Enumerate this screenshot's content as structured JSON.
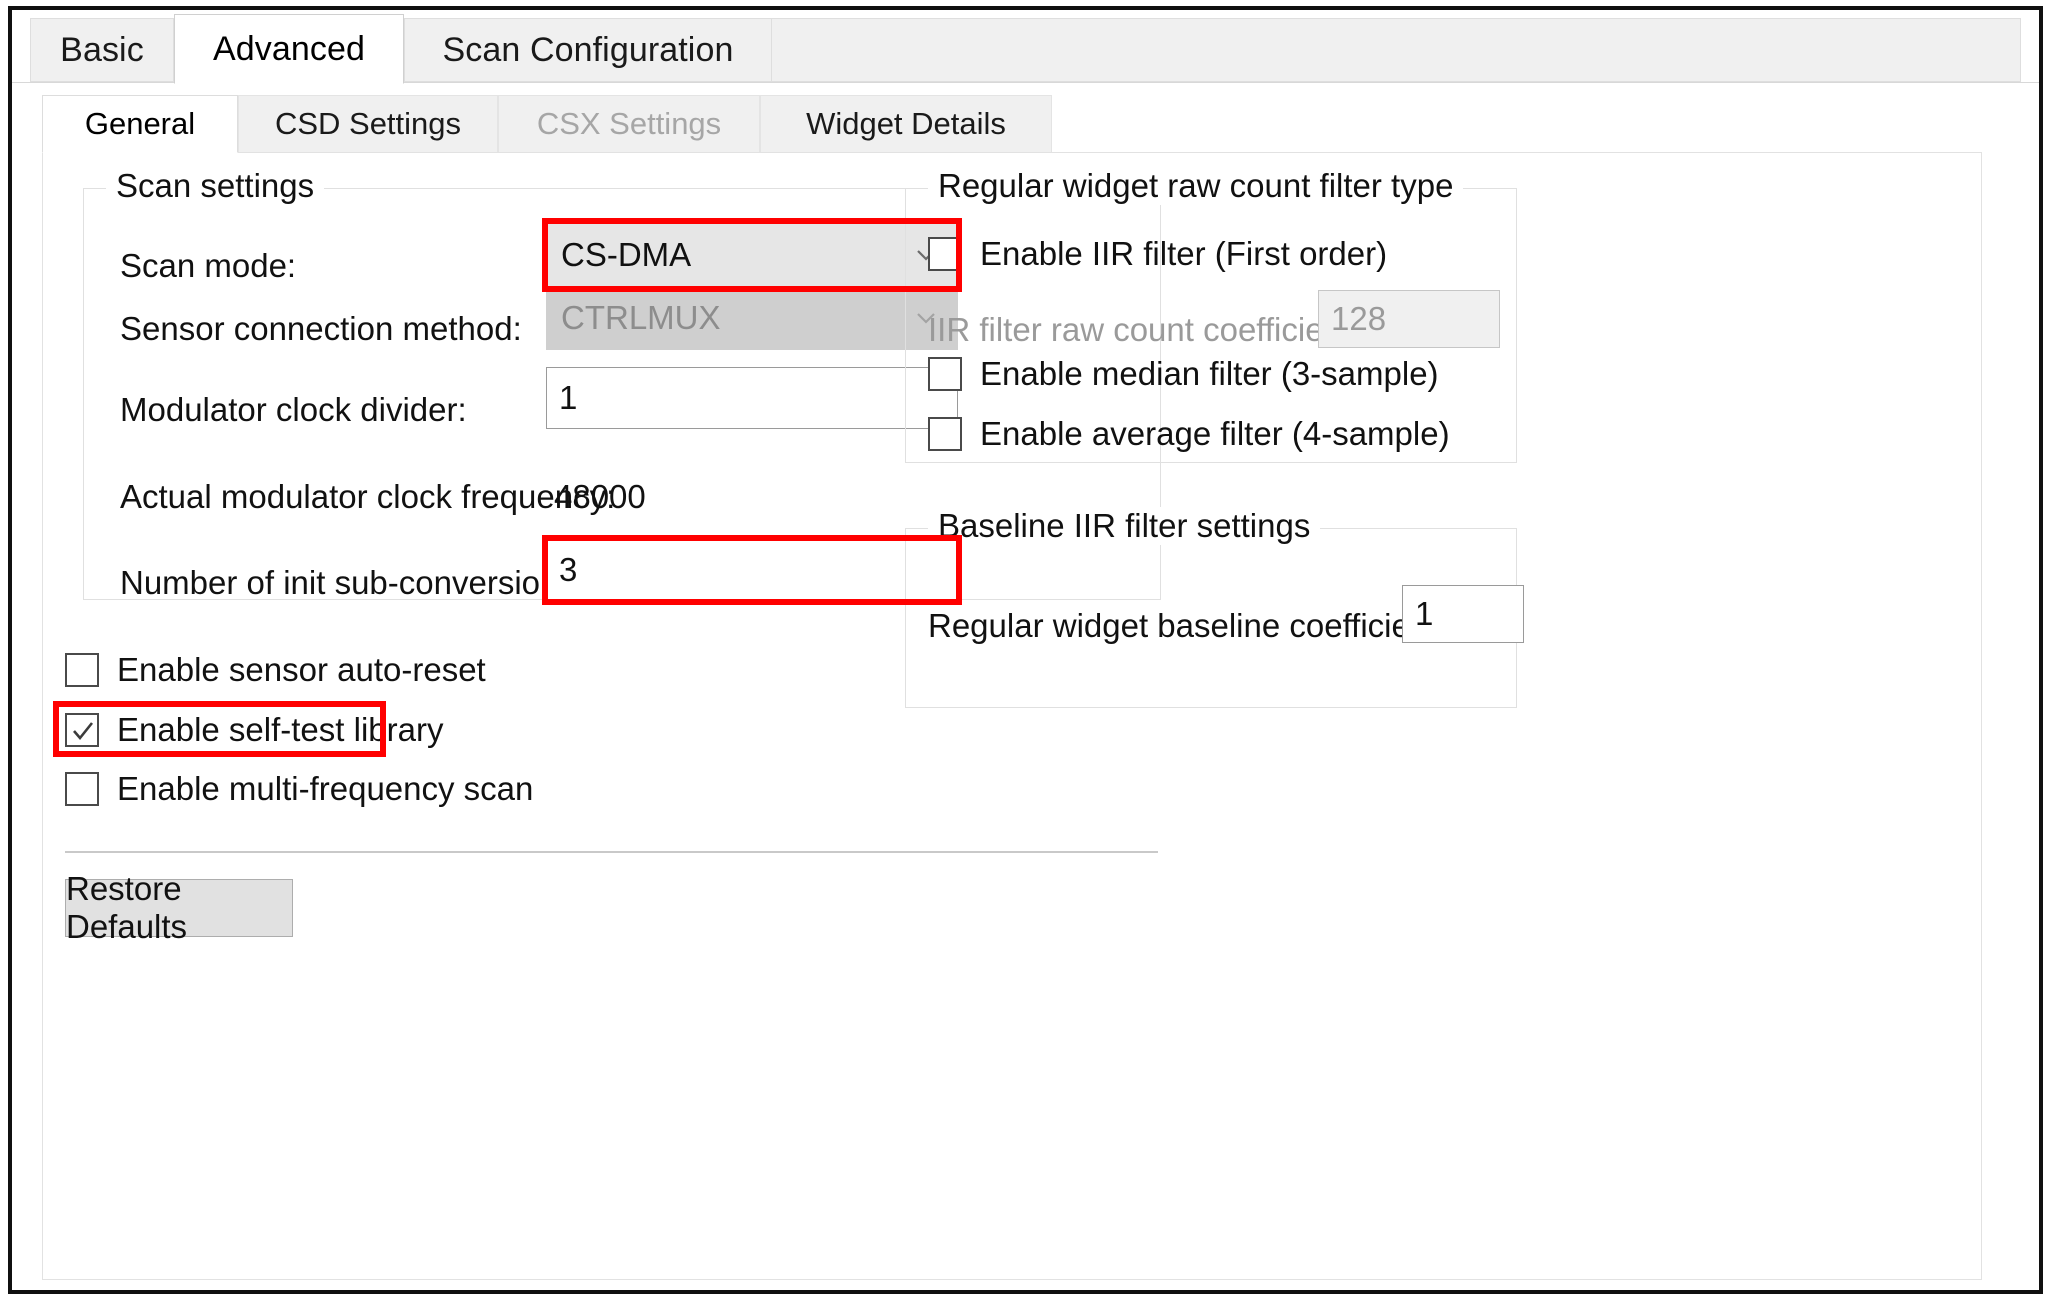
{
  "outer_tabs": [
    {
      "label": "Basic",
      "active": false
    },
    {
      "label": "Advanced",
      "active": true
    },
    {
      "label": "Scan Configuration",
      "active": false
    }
  ],
  "inner_tabs": [
    {
      "label": "General",
      "active": true,
      "disabled": false
    },
    {
      "label": "CSD Settings",
      "active": false,
      "disabled": false
    },
    {
      "label": "CSX Settings",
      "active": false,
      "disabled": true
    },
    {
      "label": "Widget Details",
      "active": false,
      "disabled": false
    }
  ],
  "scan_settings": {
    "title": "Scan settings",
    "scan_mode_label": "Scan mode:",
    "scan_mode_value": "CS-DMA",
    "sensor_connection_label": "Sensor connection method:",
    "sensor_connection_value": "CTRLMUX",
    "modulator_clock_divider_label": "Modulator clock divider:",
    "modulator_clock_divider_value": "1",
    "actual_modulator_clock_label": "Actual modulator clock frequency:",
    "actual_modulator_clock_value": "48000",
    "init_sub_conversions_label": "Number of init sub-conversions:",
    "init_sub_conversions_value": "3"
  },
  "left_checkboxes": [
    {
      "label": "Enable sensor auto-reset",
      "checked": false
    },
    {
      "label": "Enable self-test library",
      "checked": true
    },
    {
      "label": "Enable multi-frequency scan",
      "checked": false
    }
  ],
  "restore_defaults_label": "Restore Defaults",
  "raw_count_filter": {
    "title": "Regular widget raw count filter type",
    "iir_checkbox_label": "Enable IIR filter (First order)",
    "iir_checked": false,
    "iir_coefficient_label": "IIR filter raw count coefficient:",
    "iir_coefficient_value": "128",
    "median_checkbox_label": "Enable median filter (3-sample)",
    "median_checked": false,
    "average_checkbox_label": "Enable average filter (4-sample)",
    "average_checked": false
  },
  "baseline_filter": {
    "title": "Baseline IIR filter settings",
    "baseline_coefficient_label": "Regular widget baseline coefficient:",
    "baseline_coefficient_value": "1"
  },
  "icons": {
    "chevron_down": "chevron-down-icon",
    "check": "check-icon"
  },
  "colors": {
    "highlight": "#ff0000",
    "tab_inactive_bg": "#f0f0f0",
    "disabled_text": "#9a9a9a",
    "combo_bg": "#e6e6e6"
  }
}
